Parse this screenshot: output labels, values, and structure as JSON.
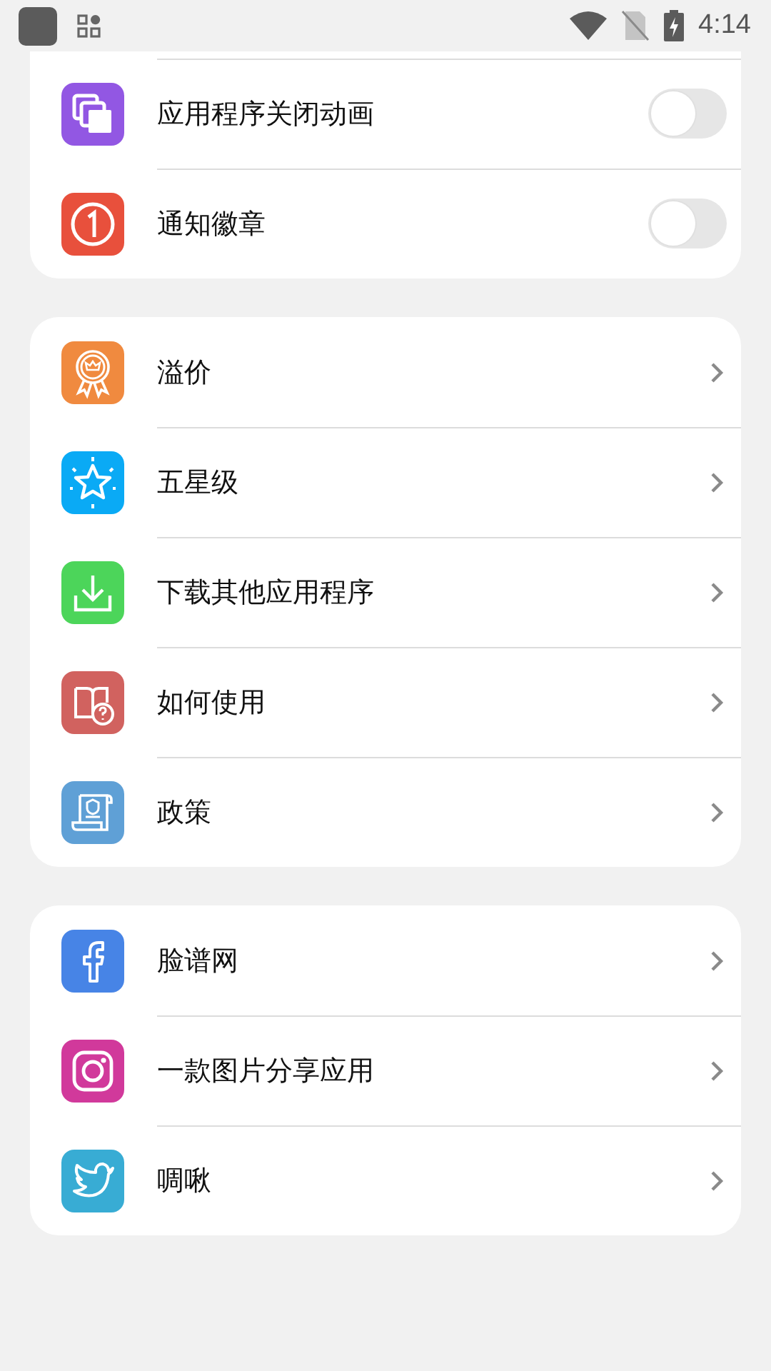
{
  "status_bar": {
    "time": "4:14"
  },
  "sections": [
    {
      "items": [
        {
          "color": "#9257e3",
          "label": "应用程序关闭动画",
          "kind": "toggle",
          "on": false
        },
        {
          "color": "#e8503c",
          "label": "通知徽章",
          "kind": "toggle",
          "on": false
        }
      ]
    },
    {
      "items": [
        {
          "color": "#f08a3f",
          "label": "溢价",
          "kind": "link"
        },
        {
          "color": "#0aaaf5",
          "label": "五星级",
          "kind": "link"
        },
        {
          "color": "#4cd55a",
          "label": "下载其他应用程序",
          "kind": "link"
        },
        {
          "color": "#d1625f",
          "label": "如何使用",
          "kind": "link"
        },
        {
          "color": "#5fa0d6",
          "label": "政策",
          "kind": "link"
        }
      ]
    },
    {
      "items": [
        {
          "color": "#4784e6",
          "label": "脸谱网",
          "kind": "link"
        },
        {
          "color": "#d1399b",
          "label": "一款图片分享应用",
          "kind": "link"
        },
        {
          "color": "#38acd4",
          "label": "啁啾",
          "kind": "link"
        }
      ]
    }
  ]
}
